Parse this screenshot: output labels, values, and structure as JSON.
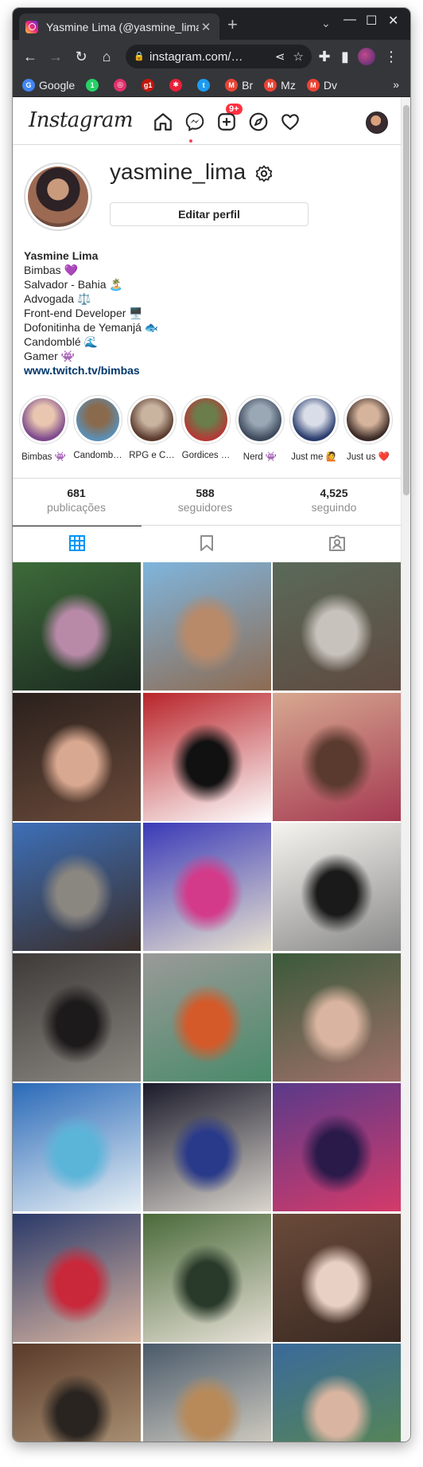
{
  "browser": {
    "tab_title": "Yasmine Lima (@yasmine_lima)",
    "tab_close": "✕",
    "new_tab": "+",
    "url": "instagram.com/…",
    "bookmarks": [
      {
        "label": "Google",
        "icon": "google-icon",
        "color": "#4285f4",
        "glyph": "G"
      },
      {
        "label": "",
        "icon": "whatsapp-icon",
        "color": "#25d366",
        "glyph": "1"
      },
      {
        "label": "",
        "icon": "instagram-icon",
        "color": "#e1306c",
        "glyph": "◎"
      },
      {
        "label": "",
        "icon": "g1-icon",
        "color": "#c4170c",
        "glyph": "g1"
      },
      {
        "label": "",
        "icon": "star-app-icon",
        "color": "#e8203a",
        "glyph": "✱"
      },
      {
        "label": "",
        "icon": "twitter-icon",
        "color": "#1d9bf0",
        "glyph": "t"
      },
      {
        "label": "Br",
        "icon": "gmail-icon",
        "color": "#ea4335",
        "glyph": "M"
      },
      {
        "label": "Mz",
        "icon": "gmail-icon",
        "color": "#ea4335",
        "glyph": "M"
      },
      {
        "label": "Dv",
        "icon": "gmail-icon",
        "color": "#ea4335",
        "glyph": "M"
      }
    ],
    "bookmarks_more": "»"
  },
  "nav": {
    "logo": "Instagram",
    "messages_badge": "9+"
  },
  "profile": {
    "username": "yasmine_lima",
    "edit_button": "Editar perfil",
    "full_name": "Yasmine Lima",
    "bio_lines": [
      "Bimbas 💜",
      "Salvador - Bahia 🏝️",
      "Advogada ⚖️",
      "Front-end Developer 🖥️",
      "Dofonitinha de Yemanjá 🐟",
      "Candomblé 🌊",
      "Gamer 👾"
    ],
    "link": "www.twitch.tv/bimbas"
  },
  "highlights": [
    {
      "label": "Bimbas 👾",
      "colors": [
        "#7e4a8c",
        "#e8c6b0"
      ]
    },
    {
      "label": "Candomb…",
      "colors": [
        "#5b8fb5",
        "#8a6a4c"
      ]
    },
    {
      "label": "RPG e C…",
      "colors": [
        "#5b3b2e",
        "#c9b4a0"
      ]
    },
    {
      "label": "Gordices …",
      "colors": [
        "#b33a36",
        "#6b7d4a"
      ]
    },
    {
      "label": "Nerd 👾",
      "colors": [
        "#3d4a5c",
        "#9aa7b5"
      ]
    },
    {
      "label": "Just me 🙋",
      "colors": [
        "#2a3d6e",
        "#d9dde8"
      ]
    },
    {
      "label": "Just us ❤️",
      "colors": [
        "#3a2a26",
        "#d6b49c"
      ]
    }
  ],
  "stats": [
    {
      "num": "681",
      "label": "publicações"
    },
    {
      "num": "588",
      "label": "seguidores"
    },
    {
      "num": "4,525",
      "label": "seguindo"
    }
  ],
  "posts": [
    {
      "colors": [
        "#3d6b3a",
        "#b88aa8",
        "#1c2a20"
      ]
    },
    {
      "colors": [
        "#7fb5dd",
        "#b88a6a",
        "#8d6b52"
      ]
    },
    {
      "colors": [
        "#5a6a5a",
        "#c8c2bc",
        "#5f4a40"
      ]
    },
    {
      "colors": [
        "#2a201c",
        "#d9a890",
        "#6a4a3a"
      ]
    },
    {
      "colors": [
        "#b8242a",
        "#111111",
        "#ffffff"
      ]
    },
    {
      "colors": [
        "#d6a890",
        "#5a3a2e",
        "#a53a52"
      ]
    },
    {
      "colors": [
        "#3d6fb8",
        "#8a8680",
        "#3a2e2a"
      ]
    },
    {
      "colors": [
        "#3a3ab8",
        "#d43a8a",
        "#e8e2d0"
      ]
    },
    {
      "colors": [
        "#f6f4ef",
        "#1a1a1a",
        "#8a8a8a"
      ]
    },
    {
      "colors": [
        "#3d3a38",
        "#1c1a1a",
        "#8a8680"
      ]
    },
    {
      "colors": [
        "#9a9a98",
        "#d45a2a",
        "#4a8a6a"
      ]
    },
    {
      "colors": [
        "#3a5a3a",
        "#d9b4a0",
        "#a0706a"
      ]
    },
    {
      "colors": [
        "#2a6ab8",
        "#5ab5d9",
        "#e8f0f5"
      ]
    },
    {
      "colors": [
        "#1a1a2a",
        "#2a3a8a",
        "#d9d4cc"
      ]
    },
    {
      "colors": [
        "#5a3a8a",
        "#2a1a4a",
        "#d43a6a"
      ]
    },
    {
      "colors": [
        "#2a3a6a",
        "#c8283a",
        "#d9b4a0"
      ]
    },
    {
      "colors": [
        "#4a6a3a",
        "#2a3a2a",
        "#e8e2d8"
      ]
    },
    {
      "colors": [
        "#6a4a3a",
        "#e8d0c4",
        "#3a2a22"
      ]
    },
    {
      "colors": [
        "#5a3a2a",
        "#2a2420",
        "#b8a080"
      ]
    },
    {
      "colors": [
        "#4a5a6a",
        "#b88a5a",
        "#e8e0d0"
      ]
    },
    {
      "colors": [
        "#3a6a9a",
        "#d9b4a0",
        "#5a8a4a"
      ]
    }
  ]
}
